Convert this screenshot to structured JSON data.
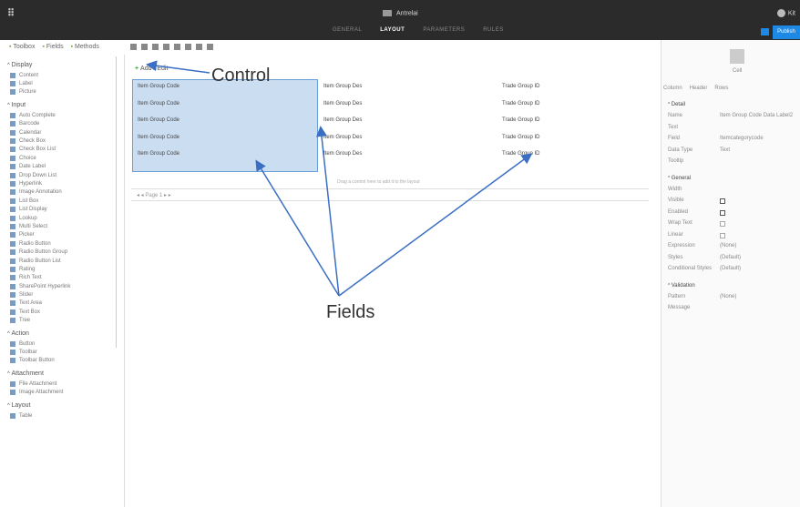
{
  "topbar": {
    "doc_title": "Antrelai",
    "user": "Kit",
    "publish": "Publish",
    "tabs": [
      "GENERAL",
      "LAYOUT",
      "PARAMETERS",
      "RULES"
    ]
  },
  "left_tabs": [
    "Toolbox",
    "Fields",
    "Methods"
  ],
  "sections": [
    {
      "title": "Display",
      "items": [
        "Content",
        "Label",
        "Picture"
      ]
    },
    {
      "title": "Input",
      "items": [
        "Auto Complete",
        "Barcode",
        "Calendar",
        "Check Box",
        "Check Box List",
        "Choice",
        "Date Label",
        "Drop Down List",
        "Hyperlink",
        "Image Annotation",
        "List Box",
        "List Display",
        "Lookup",
        "Multi Select",
        "Picker",
        "Radio Button",
        "Radio Button Group",
        "Radio Button List",
        "Rating",
        "Rich Text",
        "SharePoint Hyperlink",
        "Slider",
        "Text Area",
        "Text Box",
        "Tree"
      ]
    },
    {
      "title": "Action",
      "items": [
        "Button",
        "Toolbar",
        "Toolbar Button"
      ]
    },
    {
      "title": "Attachment",
      "items": [
        "File Attachment",
        "Image Attachment"
      ]
    },
    {
      "title": "Layout",
      "items": [
        "Table"
      ]
    }
  ],
  "canvas": {
    "add_edit": "Add / Edit",
    "rows": [
      [
        "Item Group Code",
        "Item Group Des",
        "Trade Group ID"
      ],
      [
        "Item Group Code",
        "Item Group Des",
        "Trade Group ID"
      ],
      [
        "Item Group Code",
        "Item Group Des",
        "Trade Group ID"
      ],
      [
        "Item Group Code",
        "Item Group Des",
        "Trade Group ID"
      ],
      [
        "Item Group Code",
        "Item Group Des",
        "Trade Group ID"
      ]
    ],
    "pager": "◂ ◂  Page  1  ▸ ▸",
    "hint": "Drag a control here to add it to the layout"
  },
  "annotations": {
    "control": "Control",
    "fields": "Fields"
  },
  "right": {
    "cell_label": "Cell",
    "tabs": [
      "Column",
      "Header",
      "Rows"
    ],
    "detail_title": "Detail",
    "detail": [
      [
        "Name",
        "Item Group Code Data Label2"
      ],
      [
        "Text",
        ""
      ],
      [
        "Field",
        "Itemcategorycode"
      ],
      [
        "Data Type",
        "Text"
      ],
      [
        "Tooltip",
        ""
      ]
    ],
    "general_title": "General",
    "general": [
      [
        "Width",
        ""
      ],
      [
        "Visible",
        "check"
      ],
      [
        "Enabled",
        "check"
      ],
      [
        "Wrap Text",
        "box"
      ],
      [
        "Linear",
        "box"
      ],
      [
        "Expression",
        "(None)"
      ],
      [
        "Styles",
        "(Default)"
      ],
      [
        "Conditional Styles",
        "(Default)"
      ]
    ],
    "validation_title": "Validation",
    "validation": [
      [
        "Pattern",
        "(None)"
      ],
      [
        "Message",
        ""
      ]
    ]
  }
}
